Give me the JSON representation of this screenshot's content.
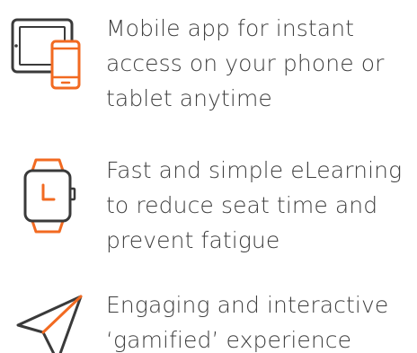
{
  "colors": {
    "accent": "#f26a21",
    "icon_dark": "#3a3a3a",
    "text": "#3f3f3f"
  },
  "features": [
    {
      "icon": "tablet-phone-icon",
      "text": "Mobile app for instant access on your phone or tablet anytime"
    },
    {
      "icon": "smartwatch-icon",
      "text": "Fast and simple eLearning to reduce seat time and prevent fatigue"
    },
    {
      "icon": "paper-plane-icon",
      "text": "Engaging and interactive ‘gamified’ experience"
    }
  ]
}
